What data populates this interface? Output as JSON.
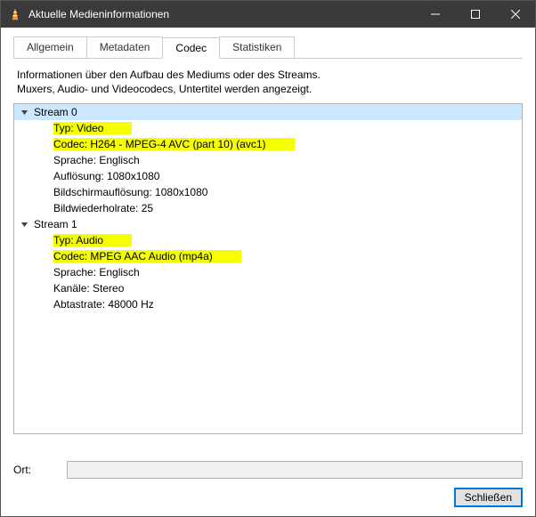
{
  "window": {
    "title": "Aktuelle Medieninformationen"
  },
  "tabs": {
    "general": "Allgemein",
    "metadata": "Metadaten",
    "codec": "Codec",
    "stats": "Statistiken"
  },
  "description": {
    "line1": "Informationen über den Aufbau des Mediums oder des Streams.",
    "line2": "Muxers, Audio- und Videocodecs, Untertitel werden angezeigt."
  },
  "tree": {
    "stream0": {
      "header": "Stream 0",
      "typ": "Typ: Video",
      "codec": "Codec: H264 - MPEG-4 AVC (part 10) (avc1)",
      "sprache": "Sprache: Englisch",
      "aufloesung": "Auflösung: 1080x1080",
      "bildschirm": "Bildschirmauflösung: 1080x1080",
      "rate": "Bildwiederholrate: 25"
    },
    "stream1": {
      "header": "Stream 1",
      "typ": "Typ: Audio",
      "codec": "Codec: MPEG AAC Audio (mp4a)",
      "sprache": "Sprache: Englisch",
      "kanaele": "Kanäle: Stereo",
      "abtast": "Abtastrate: 48000 Hz"
    }
  },
  "ort": {
    "label": "Ort:",
    "value": ""
  },
  "buttons": {
    "close": "Schließen"
  }
}
